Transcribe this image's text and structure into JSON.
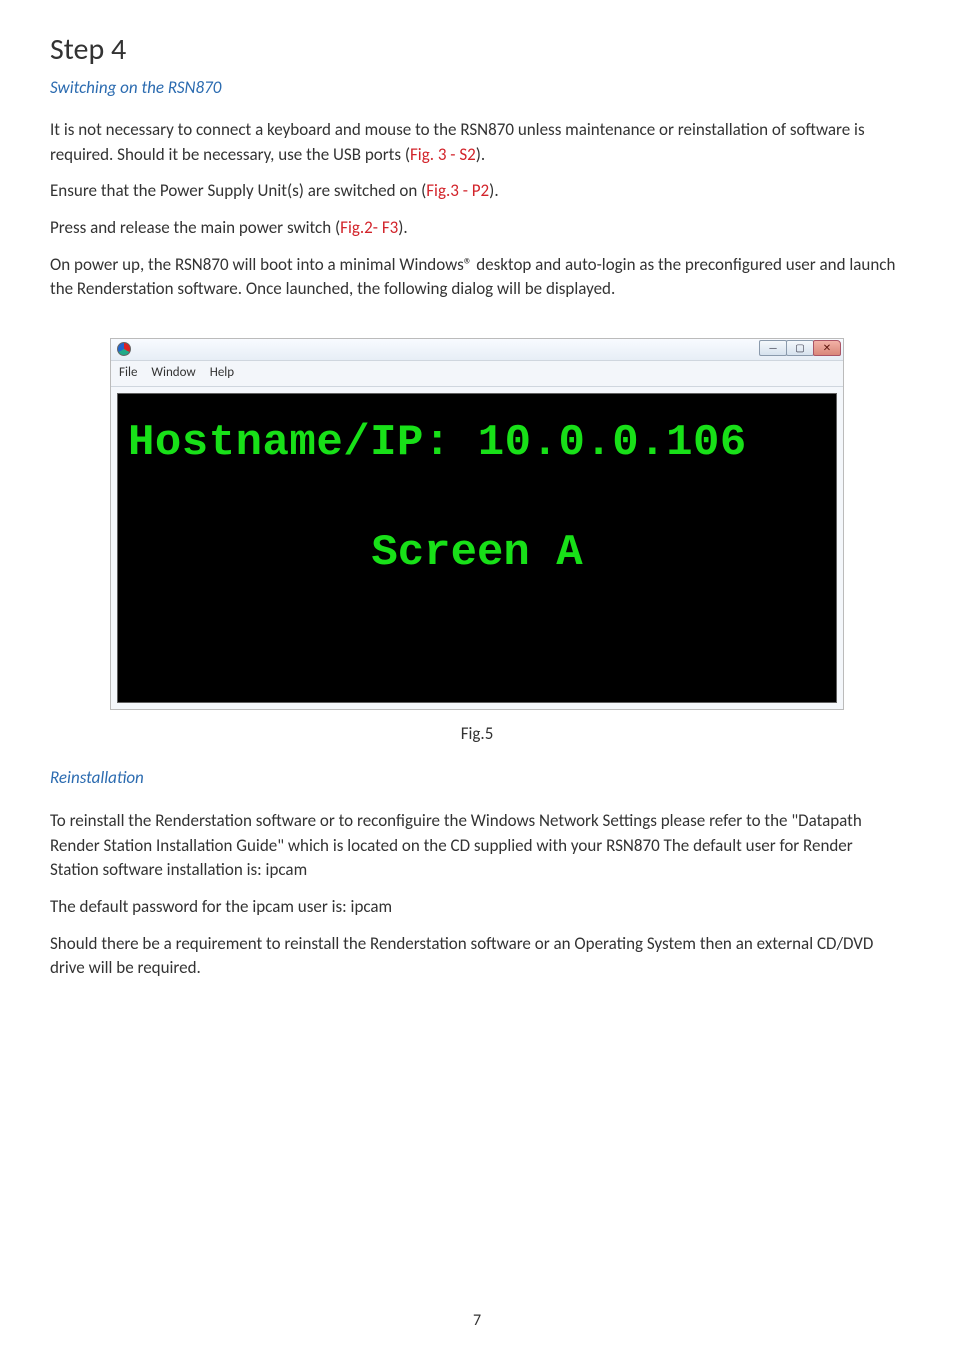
{
  "stepTitle": "Step 4",
  "section1": {
    "heading": "Switching on the RSN870",
    "p1_pre": "It is not necessary to connect a keyboard and mouse to the RSN870 unless maintenance or reinstallation of software is required.  Should it be necessary, use the USB ports (",
    "p1_ref": "Fig. 3 - S2",
    "p1_post": ").",
    "p2_pre": "Ensure that the Power Supply Unit(s) are switched on (",
    "p2_ref": "Fig.3 - P2",
    "p2_post": ").",
    "p3_pre": "Press and release the main power switch (",
    "p3_ref": "Fig.2-  F3",
    "p3_post": ").",
    "p4": "On power up, the RSN870 will boot into a minimal Windows® desktop and auto-login as the preconfigured user and launch the Renderstation software.  Once launched, the following dialog will be displayed."
  },
  "screenshot": {
    "menu": {
      "file": "File",
      "window": "Window",
      "help": "Help"
    },
    "hostline": "Hostname/IP: 10.0.0.106",
    "screenLabel": "Screen A",
    "caption": "Fig.5"
  },
  "section2": {
    "heading": "Reinstallation",
    "p1": "To reinstall the Renderstation software or to reconfiguire the Windows Network Settings please refer to the \"Datapath Render Station Installation Guide\" which is located on the CD supplied with your RSN870 The default user for Render Station software installation is:  ipcam",
    "p2": "The default password for the ipcam user is:  ipcam",
    "p3": "Should there be a requirement to reinstall the  Renderstation software or an Operating System then an external CD/DVD drive will be required."
  },
  "pageNumber": "7"
}
